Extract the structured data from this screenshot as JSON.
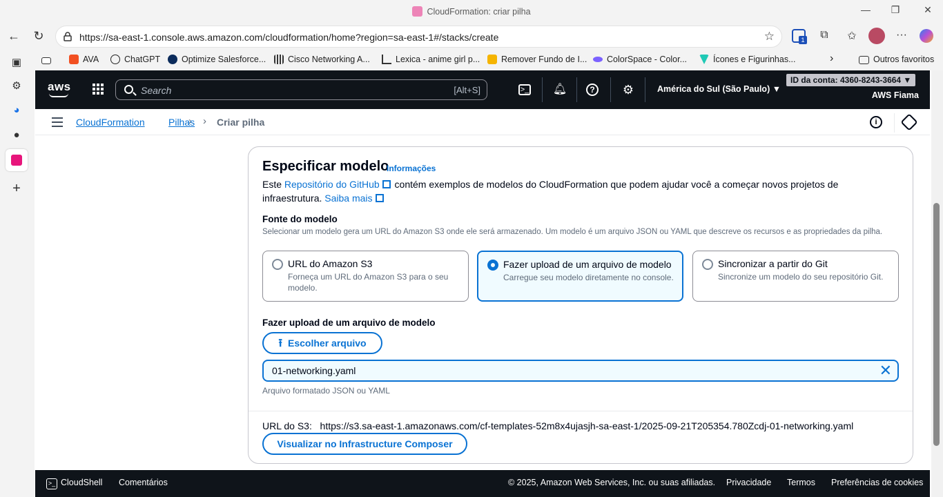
{
  "browser": {
    "window_title": "CloudFormation: criar pilha",
    "url": "https://sa-east-1.console.aws.amazon.com/cloudformation/home?region=sa-east-1#/stacks/create",
    "ext_badge": "1",
    "bookmarks": [
      "AVA",
      "ChatGPT",
      "Optimize Salesforce...",
      "Cisco Networking A...",
      "Lexica - anime girl p...",
      "Remover Fundo de I...",
      "ColorSpace - Color...",
      "Ícones e Figurinhas...",
      "Outros favoritos"
    ]
  },
  "aws_nav": {
    "logo": "aws",
    "search_placeholder": "Search",
    "search_shortcut": "[Alt+S]",
    "region": "América do Sul (São Paulo) ▼",
    "account_id": "ID da conta: 4360-8243-3664 ▼",
    "account_name": "AWS Fiama"
  },
  "breadcrumb": {
    "items": [
      "CloudFormation",
      "Pilhas",
      "Criar pilha"
    ]
  },
  "panel": {
    "title": "Especificar modelo",
    "info_link": "Informações",
    "desc_prefix": "Este",
    "desc_link1": "Repositório do GitHub",
    "desc_mid": "contém exemplos de modelos do CloudFormation que podem ajudar você a começar novos projetos de infraestrutura.",
    "desc_link2": "Saiba mais",
    "source_label": "Fonte do modelo",
    "source_desc": "Selecionar um modelo gera um URL do Amazon S3 onde ele será armazenado. Um modelo é um arquivo JSON ou YAML que descreve os recursos e as propriedades da pilha.",
    "options": [
      {
        "title": "URL do Amazon S3",
        "desc": "Forneça um URL do Amazon S3 para o seu modelo.",
        "selected": false
      },
      {
        "title": "Fazer upload de um arquivo de modelo",
        "desc": "Carregue seu modelo diretamente no console.",
        "selected": true
      },
      {
        "title": "Sincronizar a partir do Git",
        "desc": "Sincronize um modelo do seu repositório Git.",
        "selected": false
      }
    ],
    "upload_label": "Fazer upload de um arquivo de modelo",
    "choose_file": "Escolher arquivo",
    "file_name": "01-networking.yaml",
    "file_hint": "Arquivo formatado JSON ou YAML",
    "s3_label": "URL do S3:",
    "s3_url": "https://s3.sa-east-1.amazonaws.com/cf-templates-52m8x4ujasjh-sa-east-1/2025-09-21T205354.780Zcdj-01-networking.yaml",
    "composer_button": "Visualizar no Infrastructure Composer"
  },
  "footer": {
    "cloudshell": "CloudShell",
    "feedback": "Comentários",
    "copyright": "© 2025, Amazon Web Services, Inc. ou suas afiliadas.",
    "privacy": "Privacidade",
    "terms": "Termos",
    "cookies": "Preferências de cookies"
  },
  "colors": {
    "accent": "#0972d3",
    "nav_bg": "#0f141a",
    "selected_bg": "#f0fbff"
  }
}
